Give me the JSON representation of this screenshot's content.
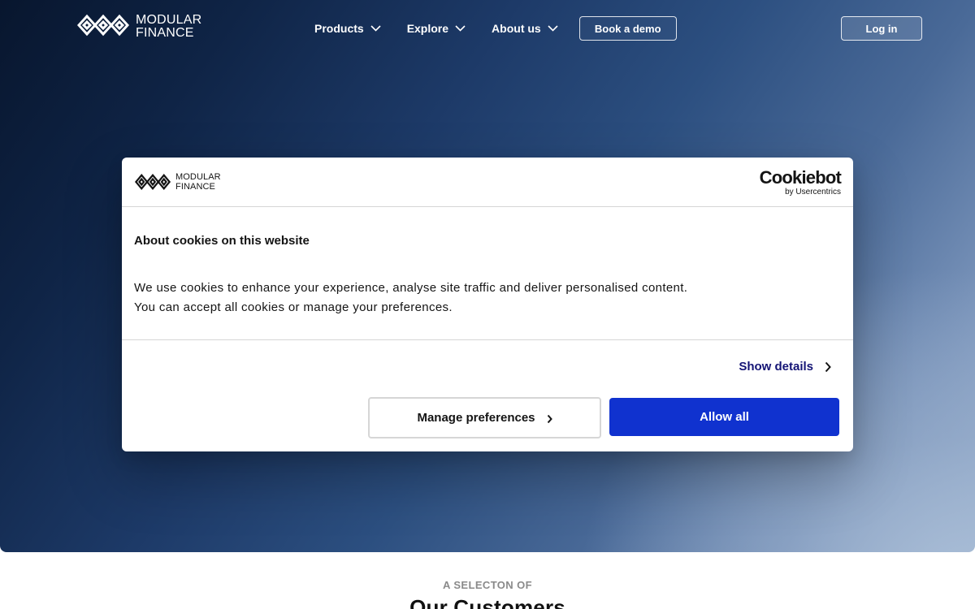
{
  "brand": {
    "name_line1": "MODULAR",
    "name_line2": "FINANCE",
    "logo_icon": "diamond-chain-logo"
  },
  "nav": {
    "items": [
      {
        "label": "Products",
        "icon": "chevron-down-icon"
      },
      {
        "label": "Explore",
        "icon": "chevron-down-icon"
      },
      {
        "label": "About us",
        "icon": "chevron-down-icon"
      }
    ],
    "book_demo": "Book a demo",
    "login": "Log in"
  },
  "cookie_dialog": {
    "brand_line1": "MODULAR",
    "brand_line2": "FINANCE",
    "provider_main": "Cookiebot",
    "provider_sub": "by Usercentrics",
    "title": "About cookies on this website",
    "text_line1": "We use cookies to enhance your experience, analyse site traffic and deliver personalised content.",
    "text_line2": "You can accept all cookies or manage your preferences.",
    "show_details": "Show details",
    "manage_preferences": "Manage preferences",
    "allow_all": "Allow all",
    "allow_color": "#1032cf"
  },
  "customers": {
    "eyebrow": "A SELECTON OF",
    "title": "Our Customers"
  }
}
